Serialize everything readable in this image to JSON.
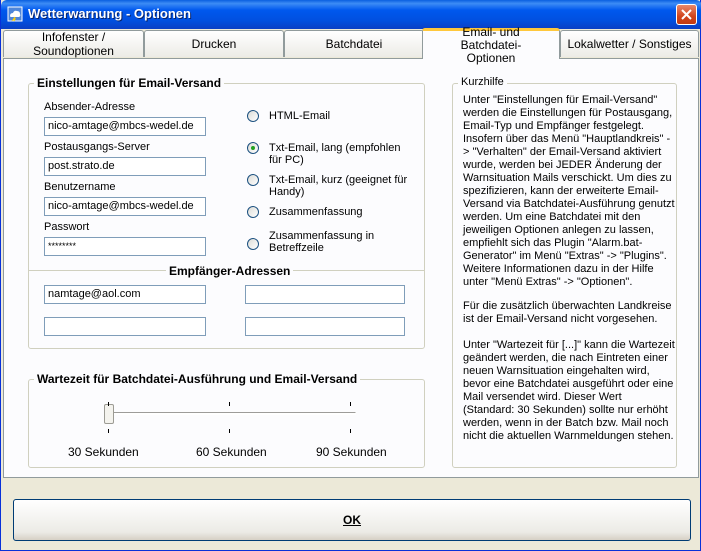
{
  "window": {
    "title": "Wetterwarnung - Optionen",
    "icon": "cloud-app-icon",
    "close_icon": "close-icon"
  },
  "tabs": [
    {
      "label": "Infofenster / Soundoptionen",
      "active": false
    },
    {
      "label": "Drucken",
      "active": false
    },
    {
      "label": "Batchdatei",
      "active": false
    },
    {
      "label": "Email- und Batchdatei-Optionen",
      "active": true
    },
    {
      "label": "Lokalwetter / Sonstiges",
      "active": false
    }
  ],
  "email": {
    "group_title": "Einstellungen für Email-Versand",
    "sender_label": "Absender-Adresse",
    "sender_value": "nico-amtage@mbcs-wedel.de",
    "server_label": "Postausgangs-Server",
    "server_value": "post.strato.de",
    "user_label": "Benutzername",
    "user_value": "nico-amtage@mbcs-wedel.de",
    "password_label": "Passwort",
    "password_value": "********",
    "recipients_title": "Empfänger-Adressen",
    "recipients": [
      "namtage@aol.com",
      "",
      "",
      ""
    ],
    "format_options": [
      {
        "label": "HTML-Email",
        "checked": false
      },
      {
        "label": "Txt-Email, lang (empfohlen für PC)",
        "checked": true
      },
      {
        "label": "Txt-Email, kurz (geeignet für Handy)",
        "checked": false
      },
      {
        "label": "Zusammenfassung",
        "checked": false
      },
      {
        "label": "Zusammenfassung in Betreffzeile",
        "checked": false
      }
    ]
  },
  "wait": {
    "group_title": "Wartezeit für Batchdatei-Ausführung und Email-Versand",
    "tick_labels": [
      "30 Sekunden",
      "60 Sekunden",
      "90 Sekunden"
    ],
    "value_seconds": 30
  },
  "help": {
    "title": "Kurzhilfe",
    "paragraph1": "Unter \"Einstellungen für Email-Versand\" werden die Einstellungen für Postausgang, Email-Typ und Empfänger festgelegt. Insofern über das Menü \"Hauptlandkreis\" -> \"Verhalten\" der Email-Versand aktiviert wurde, werden bei JEDER Änderung der Warnsituation Mails verschickt. Um dies zu spezifizieren, kann der erweiterte Email-Versand via Batchdatei-Ausführung genutzt werden. Um eine Batchdatei mit den jeweiligen Optionen anlegen zu lassen, empfiehlt sich das Plugin \"Alarm.bat-Generator\" im Menü \"Extras\" -> \"Plugins\". Weitere Informationen dazu in der Hilfe unter \"Menü Extras\" -> \"Optionen\".",
    "paragraph2": "Für die zusätzlich überwachten Landkreise ist der Email-Versand nicht vorgesehen.",
    "paragraph3": "Unter \"Wartezeit für [...]\" kann die Wartezeit geändert werden, die nach Eintreten einer neuen Warnsituation eingehalten wird, bevor eine Batchdatei ausgeführt oder eine Mail versendet wird. Dieser Wert (Standard: 30 Sekunden) sollte nur erhöht werden, wenn in der Batch bzw. Mail noch nicht die aktuellen Warnmeldungen stehen."
  },
  "ok_label": "OK",
  "colors": {
    "titlebar": "#0058ee",
    "active_tab_accent": "#ffc83c",
    "radio_dot": "#21a121"
  }
}
